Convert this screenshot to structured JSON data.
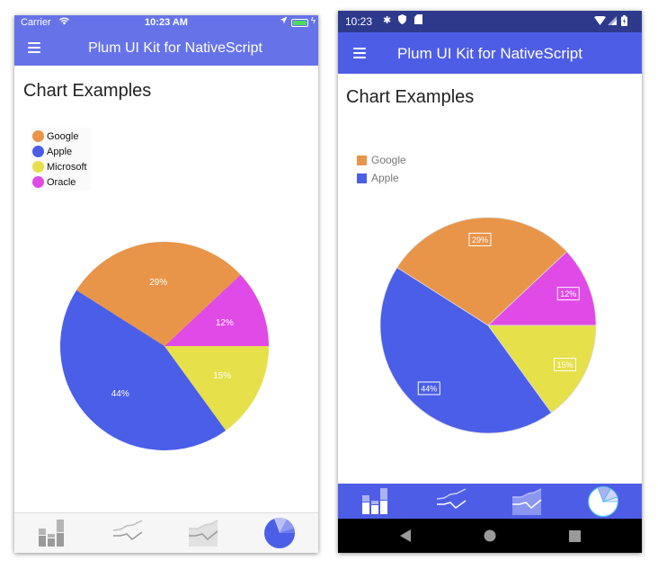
{
  "ios": {
    "status": {
      "carrier": "Carrier",
      "time": "10:23 AM",
      "wifi_icon": "wifi-icon",
      "location_icon": "location-icon",
      "battery_icon": "battery-icon",
      "battery_color": "#4cd964"
    },
    "header": {
      "title": "Plum UI Kit for NativeScript",
      "menu_icon": "hamburger-icon",
      "bg": "#6673e8"
    },
    "page_title": "Chart Examples",
    "legend": [
      {
        "label": "Google",
        "color": "#e8954a"
      },
      {
        "label": "Apple",
        "color": "#4b5ee8"
      },
      {
        "label": "Microsoft",
        "color": "#e6e04a"
      },
      {
        "label": "Oracle",
        "color": "#e04ae6"
      }
    ],
    "tabs": [
      {
        "name": "bar-chart-tab",
        "icon": "bar-chart-icon",
        "active": false
      },
      {
        "name": "line-chart-tab",
        "icon": "line-chart-icon",
        "active": false
      },
      {
        "name": "area-chart-tab",
        "icon": "area-chart-icon",
        "active": false
      },
      {
        "name": "pie-chart-tab",
        "icon": "pie-chart-icon",
        "active": true
      }
    ]
  },
  "android": {
    "status": {
      "time": "10:23",
      "icons": [
        "settings-icon",
        "shield-icon",
        "sd-card-icon"
      ],
      "right_icons": [
        "wifi-icon",
        "signal-icon",
        "battery-icon"
      ]
    },
    "header": {
      "title": "Plum UI Kit for NativeScript",
      "menu_icon": "hamburger-icon",
      "bg": "#4e5de6"
    },
    "page_title": "Chart Examples",
    "legend": [
      {
        "label": "Google",
        "color": "#e8954a"
      },
      {
        "label": "Apple",
        "color": "#4b5ee8"
      }
    ],
    "tabs": [
      {
        "name": "bar-chart-tab",
        "icon": "bar-chart-icon",
        "active": false
      },
      {
        "name": "line-chart-tab",
        "icon": "line-chart-icon",
        "active": false
      },
      {
        "name": "area-chart-tab",
        "icon": "area-chart-icon",
        "active": false
      },
      {
        "name": "pie-chart-tab",
        "icon": "pie-chart-icon",
        "active": true
      }
    ],
    "system_nav": [
      "back-icon",
      "home-icon",
      "recents-icon"
    ]
  },
  "chart_data": [
    {
      "type": "pie",
      "title": "",
      "platform": "iOS",
      "labels": [
        "Oracle",
        "Google",
        "Apple",
        "Microsoft"
      ],
      "values": [
        12,
        29,
        44,
        15
      ],
      "value_labels": [
        "12%",
        "29%",
        "44%",
        "15%"
      ],
      "colors": [
        "#e04ae6",
        "#e8954a",
        "#4b5ee8",
        "#e6e04a"
      ],
      "legend_position": "top-left"
    },
    {
      "type": "pie",
      "title": "",
      "platform": "Android",
      "labels": [
        "Oracle",
        "Google",
        "Apple",
        "Microsoft"
      ],
      "values": [
        12,
        29,
        44,
        15
      ],
      "value_labels": [
        "12%",
        "29%",
        "44%",
        "15%"
      ],
      "colors": [
        "#e04ae6",
        "#e8954a",
        "#4b5ee8",
        "#e6e04a"
      ],
      "legend_position": "top-left"
    }
  ]
}
